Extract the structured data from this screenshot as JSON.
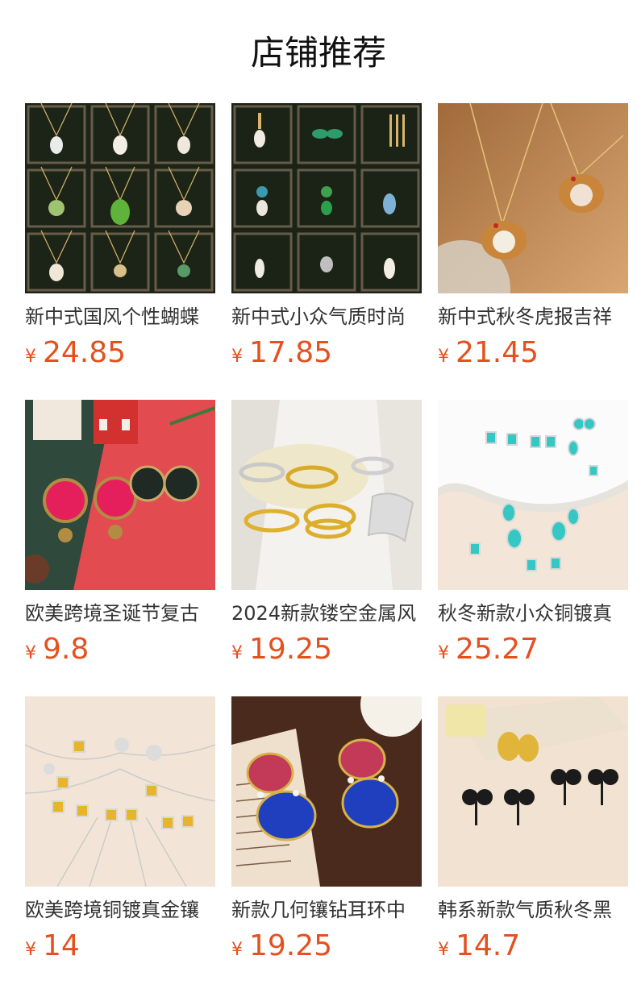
{
  "section": {
    "title": "店铺推荐"
  },
  "currency": "¥",
  "products": [
    {
      "name": "新中式国风个性蝴蝶",
      "price": "24.85",
      "image": "jade-pendant-necklaces-grid"
    },
    {
      "name": "新中式小众气质时尚",
      "price": "17.85",
      "image": "jade-drop-earrings-grid"
    },
    {
      "name": "新中式秋冬虎报吉祥",
      "price": "21.45",
      "image": "tiger-pearl-pendant-necklace"
    },
    {
      "name": "欧美跨境圣诞节复古",
      "price": "9.8",
      "image": "christmas-button-earrings"
    },
    {
      "name": "2024新款镂空金属风",
      "price": "19.25",
      "image": "metal-cuff-bracelets"
    },
    {
      "name": "秋冬新款小众铜镀真",
      "price": "25.27",
      "image": "aqua-stone-earrings"
    },
    {
      "name": "欧美跨境铜镀真金镶",
      "price": "14",
      "image": "yellow-crystal-necklaces"
    },
    {
      "name": "新款几何镶钻耳环中",
      "price": "19.25",
      "image": "red-blue-gem-earrings"
    },
    {
      "name": "韩系新款气质秋冬黑",
      "price": "14.7",
      "image": "black-bow-earrings"
    }
  ]
}
